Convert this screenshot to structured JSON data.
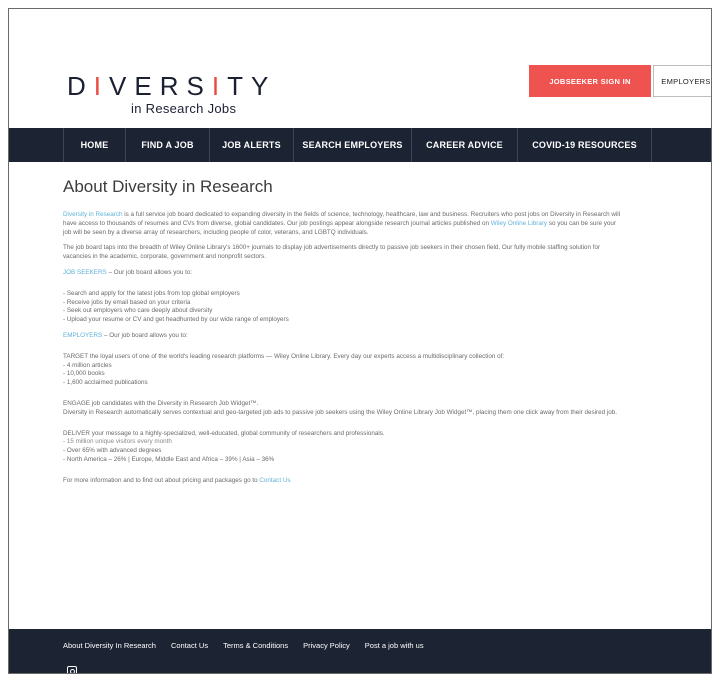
{
  "header": {
    "logo_main_a": "D",
    "logo_bar_1": "I",
    "logo_main_b": "VERS",
    "logo_bar_2": "I",
    "logo_main_c": "TY",
    "logo_sub": "in Research Jobs",
    "jobseeker_label": "JOBSEEKER SIGN IN",
    "employers_label": "EMPLOYERS"
  },
  "nav": {
    "items": [
      {
        "label": "HOME"
      },
      {
        "label": "FIND A JOB"
      },
      {
        "label": "JOB ALERTS"
      },
      {
        "label": "SEARCH EMPLOYERS"
      },
      {
        "label": "CAREER ADVICE"
      },
      {
        "label": "COVID-19 RESOURCES"
      }
    ]
  },
  "main": {
    "title": "About Diversity in Research",
    "p1_link": "Diversity in Research",
    "p1_text_a": " is a full service job board dedicated to expanding diversity in the fields of science, technology, healthcare, law and business. Recruiters who post jobs on Diversity in Research will have access to thousands of resumes and CVs from diverse, global candidates. Our job postings appear alongside research journal articles published on ",
    "p1_link2": "Wiley Online Library",
    "p1_text_b": " so you can be sure your job will be seen by a diverse array of researchers, including people of color, veterans, and LGBTQ individuals.",
    "p2": "The job board taps into the breadth of Wiley Online Library's 1600+ journals to display job advertisements directly to passive job seekers in their chosen field. Our fully mobile staffing solution for vacancies in the academic, corporate, government and nonprofit sectors.",
    "jobseekers_label": "JOB SEEKERS",
    "jobseekers_text": " – Our job board allows you to:",
    "jobseekers_list": [
      "- Search and apply for the latest jobs from top global employers",
      "- Receive jobs by email based on your criteria",
      "- Seek out employers who care deeply about diversity",
      "- Upload your resume or CV and get headhunted by our wide range of employers"
    ],
    "employers_label": "EMPLOYERS",
    "employers_text": " – Our job board allows you to:",
    "target_text": "TARGET the loyal users of one of the world's leading research platforms — Wiley Online Library. Every day our experts access a multidisciplinary collection of:",
    "target_list": [
      "- 4 million articles",
      "- 10,000 books",
      "- 1,600 acclaimed publications"
    ],
    "engage_line1": "ENGAGE job candidates with the Diversity in Research Job Widget™.",
    "engage_line2": "Diversity in Research automatically serves contextual and geo-targeted job ads to passive job seekers using the Wiley Online Library Job Widget™, placing them one click away from their desired job.",
    "deliver_line": "DELIVER your message to a highly-specialized, well-educated, global community of researchers and professionals.",
    "deliver_list": [
      "- 15 million unique visitors every month",
      "- Over 65% with advanced degrees",
      "- North America – 26% | Europe, Middle East and Africa – 39% | Asia – 36%"
    ],
    "more_text": "For more information and to find out about pricing and packages go to ",
    "more_link": "Contact Us"
  },
  "footer": {
    "links": [
      {
        "label": "About Diversity In Research"
      },
      {
        "label": "Contact Us"
      },
      {
        "label": "Terms & Conditions"
      },
      {
        "label": "Privacy Policy"
      },
      {
        "label": "Post a job with us"
      }
    ],
    "social_icon": "instagram-icon"
  },
  "colors": {
    "accent_red": "#ef5350",
    "nav_bg": "#1c2434",
    "link_blue": "#5fb2d8"
  }
}
